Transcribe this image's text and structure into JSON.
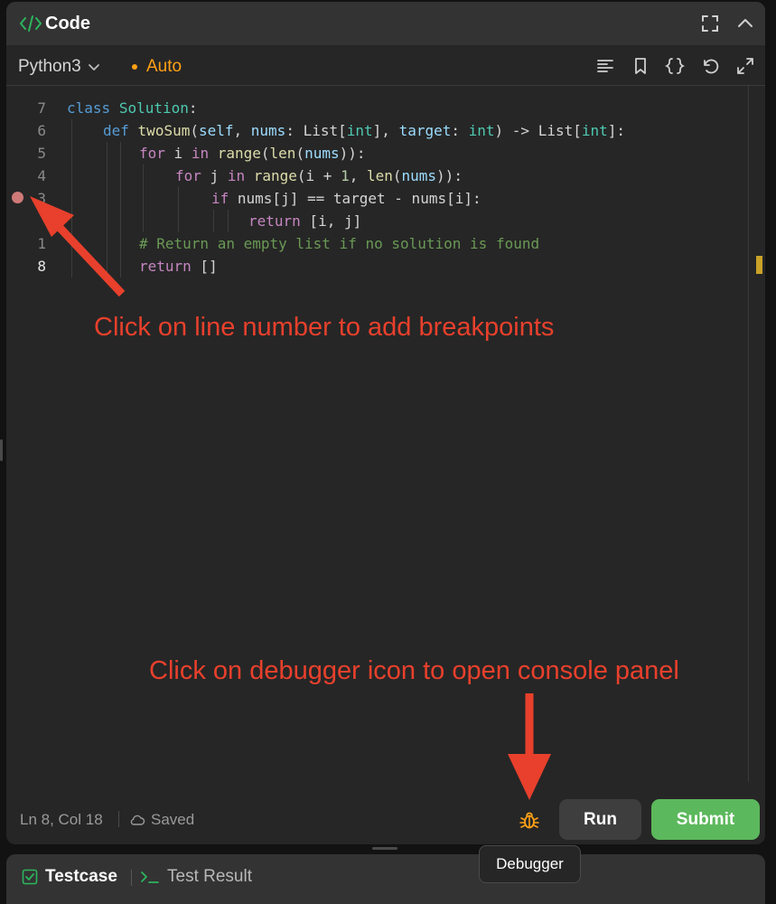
{
  "header": {
    "title": "Code",
    "icon": "code-icon",
    "actions": [
      "fullscreen-icon",
      "chevron-up-icon"
    ]
  },
  "toolbar": {
    "language": "Python3",
    "mode": "Auto",
    "actions": [
      "format-icon",
      "bookmark-icon",
      "braces-icon",
      "reset-icon",
      "expand-icon"
    ]
  },
  "editor": {
    "breakpoint_line": "3",
    "lines": [
      {
        "num": "7",
        "text": "class Solution:"
      },
      {
        "num": "6",
        "text": "def twoSum(self, nums: List[int], target: int) -> List[int]:"
      },
      {
        "num": "5",
        "text": "for i in range(len(nums)):"
      },
      {
        "num": "4",
        "text": "for j in range(i + 1, len(nums)):"
      },
      {
        "num": "3",
        "text": "if nums[j] == target - nums[i]:"
      },
      {
        "num": "",
        "text": "return [i, j]"
      },
      {
        "num": "1",
        "text": "# Return an empty list if no solution is found"
      },
      {
        "num": "8",
        "text": "return []"
      }
    ]
  },
  "status": {
    "position": "Ln 8, Col 18",
    "saved": "Saved",
    "run_label": "Run",
    "submit_label": "Submit",
    "debugger_tooltip": "Debugger"
  },
  "bottom_tabs": {
    "testcase": "Testcase",
    "result": "Test Result"
  },
  "annotations": {
    "breakpoints": "Click on line number to add breakpoints",
    "debugger": "Click on debugger icon to open console panel"
  },
  "colors": {
    "accent_orange": "#ffa116",
    "submit_green": "#5cb85c",
    "annotation_red": "#e8402c",
    "breakpoint": "#cf7a79"
  }
}
